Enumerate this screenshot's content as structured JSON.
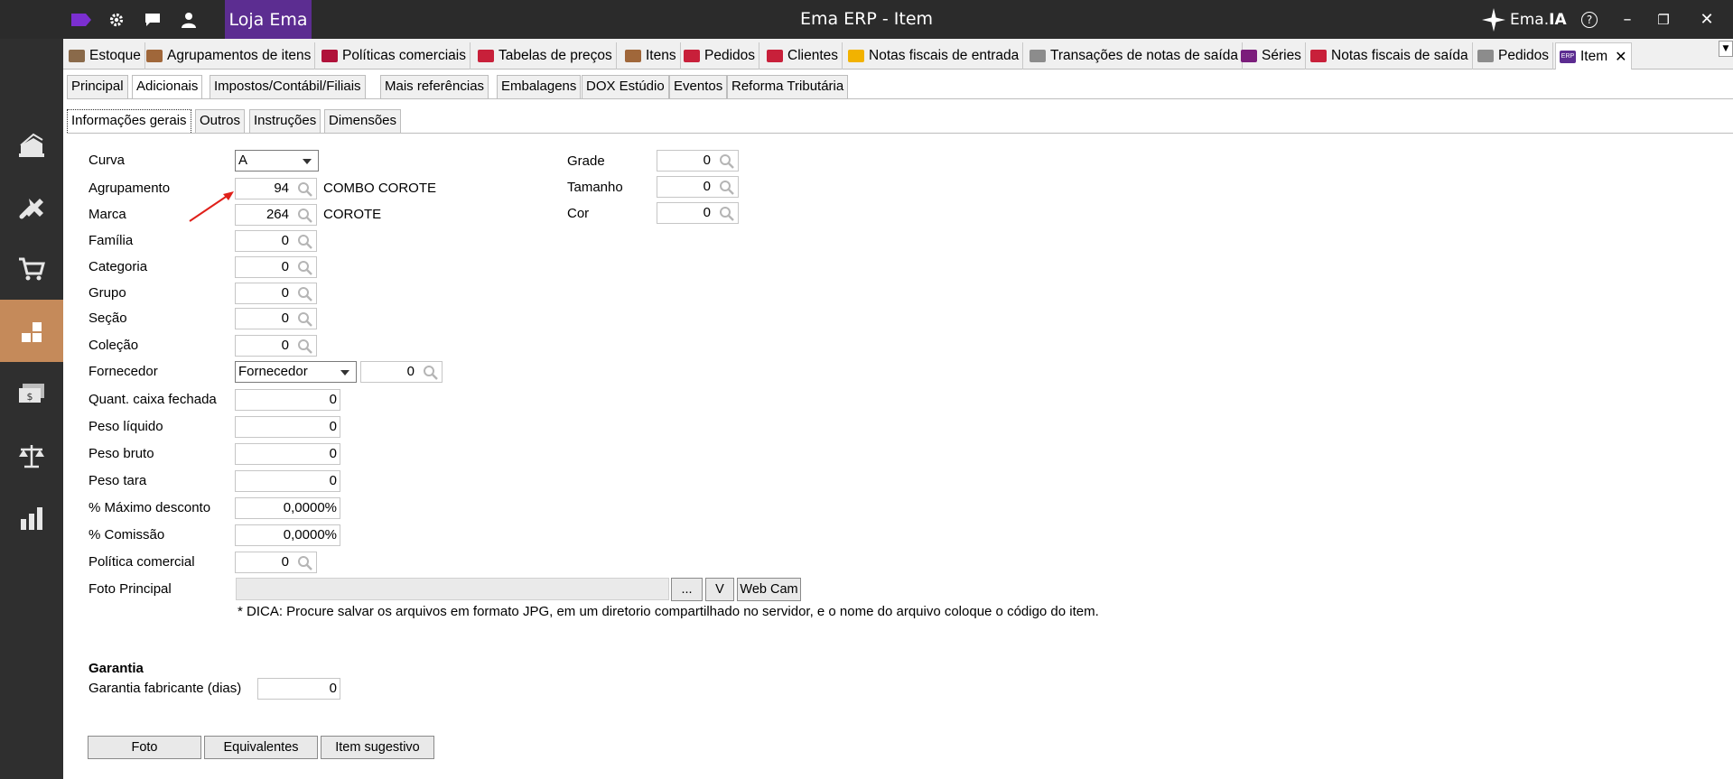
{
  "titlebar": {
    "company": "Loja Ema",
    "title": "Ema ERP - Item",
    "assistant_brand": "Ema.",
    "assistant_brand_bold": "IA",
    "help": "?",
    "minimize": "–",
    "restore": "❐",
    "close": "✕"
  },
  "sidebar": {
    "items": [
      {
        "icon": "stock-icon"
      },
      {
        "icon": "tools-icon"
      },
      {
        "icon": "cart-icon"
      },
      {
        "icon": "boxes-icon",
        "active": true
      },
      {
        "icon": "money-icon"
      },
      {
        "icon": "scale-icon"
      },
      {
        "icon": "bar-chart-icon"
      }
    ]
  },
  "doctabs": [
    {
      "label": "Estoque",
      "color": "#8a6a4a"
    },
    {
      "label": "Agrupamentos de itens",
      "color": "#a0673a"
    },
    {
      "label": "Políticas comerciais",
      "color": "#b0123a"
    },
    {
      "label": "Tabelas de preços",
      "color": "#c8203a"
    },
    {
      "label": "Itens",
      "color": "#a0673a"
    },
    {
      "label": "Pedidos",
      "color": "#c8203a"
    },
    {
      "label": "Clientes",
      "color": "#c8203a"
    },
    {
      "label": "Notas fiscais de entrada",
      "color": "#f2b200"
    },
    {
      "label": "Transações de notas de saída",
      "color": "#8c8c8c"
    },
    {
      "label": "Séries",
      "color": "#7b1d7b"
    },
    {
      "label": "Notas fiscais de saída",
      "color": "#c8203a"
    },
    {
      "label": "Pedidos",
      "color": "#8c8c8c"
    },
    {
      "label": "Item",
      "color": "#5c2d91",
      "active": true,
      "badge": "ERP"
    }
  ],
  "pagetabs": [
    "Principal",
    "Adicionais",
    "Impostos/Contábil/Filiais",
    "Mais referências",
    "Embalagens",
    "DOX Estúdio",
    "Eventos",
    "Reforma Tributária"
  ],
  "subtabs": [
    "Informações gerais",
    "Outros",
    "Instruções",
    "Dimensões"
  ],
  "form": {
    "curva": {
      "label": "Curva",
      "value": "A"
    },
    "agrupamento": {
      "label": "Agrupamento",
      "value": "94",
      "desc": "COMBO COROTE"
    },
    "marca": {
      "label": "Marca",
      "value": "264",
      "desc": "COROTE"
    },
    "familia": {
      "label": "Família",
      "value": "0"
    },
    "categoria": {
      "label": "Categoria",
      "value": "0"
    },
    "grupo": {
      "label": "Grupo",
      "value": "0"
    },
    "secao": {
      "label": "Seção",
      "value": "0"
    },
    "colecao": {
      "label": "Coleção",
      "value": "0"
    },
    "fornecedor": {
      "label": "Fornecedor",
      "select": "Fornecedor",
      "value": "0"
    },
    "quant_caixa": {
      "label": "Quant. caixa fechada",
      "value": "0"
    },
    "peso_liquido": {
      "label": "Peso líquido",
      "value": "0"
    },
    "peso_bruto": {
      "label": "Peso bruto",
      "value": "0"
    },
    "peso_tara": {
      "label": "Peso tara",
      "value": "0"
    },
    "max_desconto": {
      "label": "% Máximo desconto",
      "value": "0,0000%"
    },
    "comissao": {
      "label": "% Comissão",
      "value": "0,0000%"
    },
    "politica": {
      "label": "Política comercial",
      "value": "0"
    },
    "foto": {
      "label": "Foto Principal",
      "btn_browse": "...",
      "btn_view": "V",
      "btn_webcam": "Web Cam"
    },
    "tip": "* DICA: Procure salvar os arquivos em formato JPG, em um diretorio compartilhado no servidor, e o nome do arquivo coloque o código do item.",
    "grade": {
      "label": "Grade",
      "value": "0"
    },
    "tamanho": {
      "label": "Tamanho",
      "value": "0"
    },
    "cor": {
      "label": "Cor",
      "value": "0"
    },
    "garantia_title": "Garantia",
    "garantia": {
      "label": "Garantia fabricante (dias)",
      "value": "0"
    }
  },
  "buttons": {
    "foto": "Foto",
    "equivalentes": "Equivalentes",
    "item_sugestivo": "Item sugestivo"
  },
  "accent": "#5c2d91",
  "sidebar_active_color": "#c58a5a"
}
